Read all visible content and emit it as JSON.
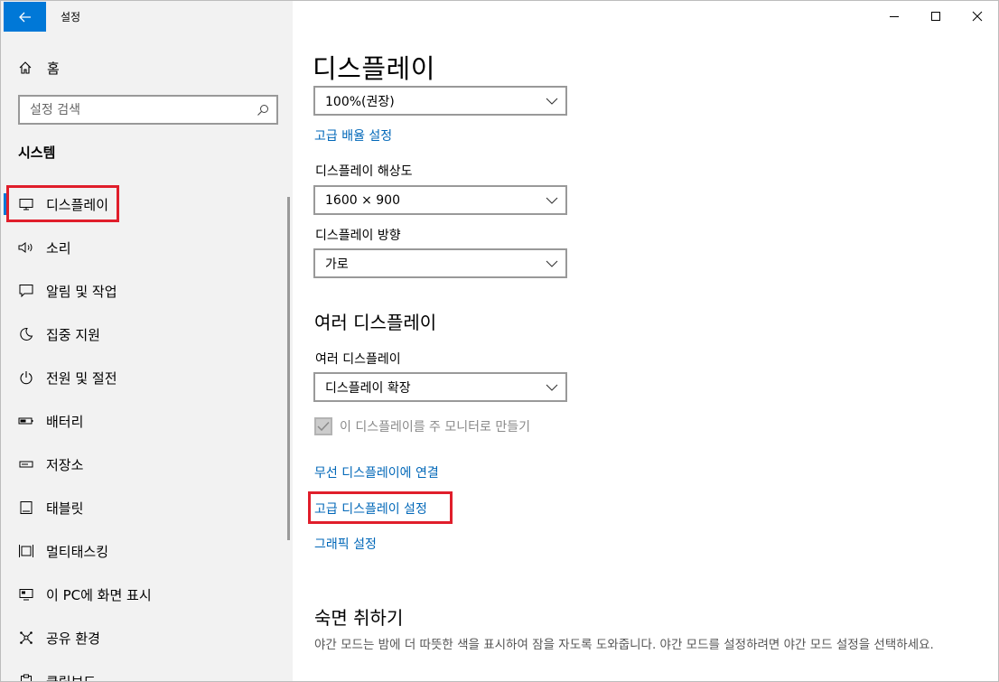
{
  "window": {
    "title": "설정",
    "controls": {
      "minimize": "minimize-icon",
      "maximize": "maximize-icon",
      "close": "close-icon"
    }
  },
  "sidebar": {
    "home_label": "홈",
    "search_placeholder": "설정 검색",
    "section_title": "시스템",
    "items": [
      {
        "label": "디스플레이",
        "icon": "monitor-icon",
        "active": true
      },
      {
        "label": "소리",
        "icon": "speaker-icon"
      },
      {
        "label": "알림 및 작업",
        "icon": "notification-icon"
      },
      {
        "label": "집중 지원",
        "icon": "moon-icon"
      },
      {
        "label": "전원 및 절전",
        "icon": "power-icon"
      },
      {
        "label": "배터리",
        "icon": "battery-icon"
      },
      {
        "label": "저장소",
        "icon": "storage-icon"
      },
      {
        "label": "태블릿",
        "icon": "tablet-icon"
      },
      {
        "label": "멀티태스킹",
        "icon": "multitasking-icon"
      },
      {
        "label": "이 PC에 화면 표시",
        "icon": "project-icon"
      },
      {
        "label": "공유 환경",
        "icon": "shared-experiences-icon"
      },
      {
        "label": "클립보드",
        "icon": "clipboard-icon"
      }
    ]
  },
  "main": {
    "page_title": "디스플레이",
    "scale_value": "100%(권장)",
    "advanced_scaling_link": "고급 배율 설정",
    "resolution_label": "디스플레이 해상도",
    "resolution_value": "1600 × 900",
    "orientation_label": "디스플레이 방향",
    "orientation_value": "가로",
    "multi_heading": "여러 디스플레이",
    "multi_label": "여러 디스플레이",
    "multi_value": "디스플레이 확장",
    "main_display_checkbox": "이 디스플레이를 주 모니터로 만들기",
    "main_display_checked": true,
    "wireless_link": "무선 디스플레이에 연결",
    "advanced_display_link": "고급 디스플레이 설정",
    "graphics_link": "그래픽 설정",
    "sleep_heading": "숙면 취하기",
    "sleep_desc": "야간 모드는 밤에 더 따뜻한 색을 표시하여 잠을 자도록 도와줍니다. 야간 모드를 설정하려면 야간 모드 설정을 선택하세요."
  },
  "colors": {
    "accent": "#0078d7",
    "link": "#0067b8",
    "highlight": "#e01e2b"
  }
}
